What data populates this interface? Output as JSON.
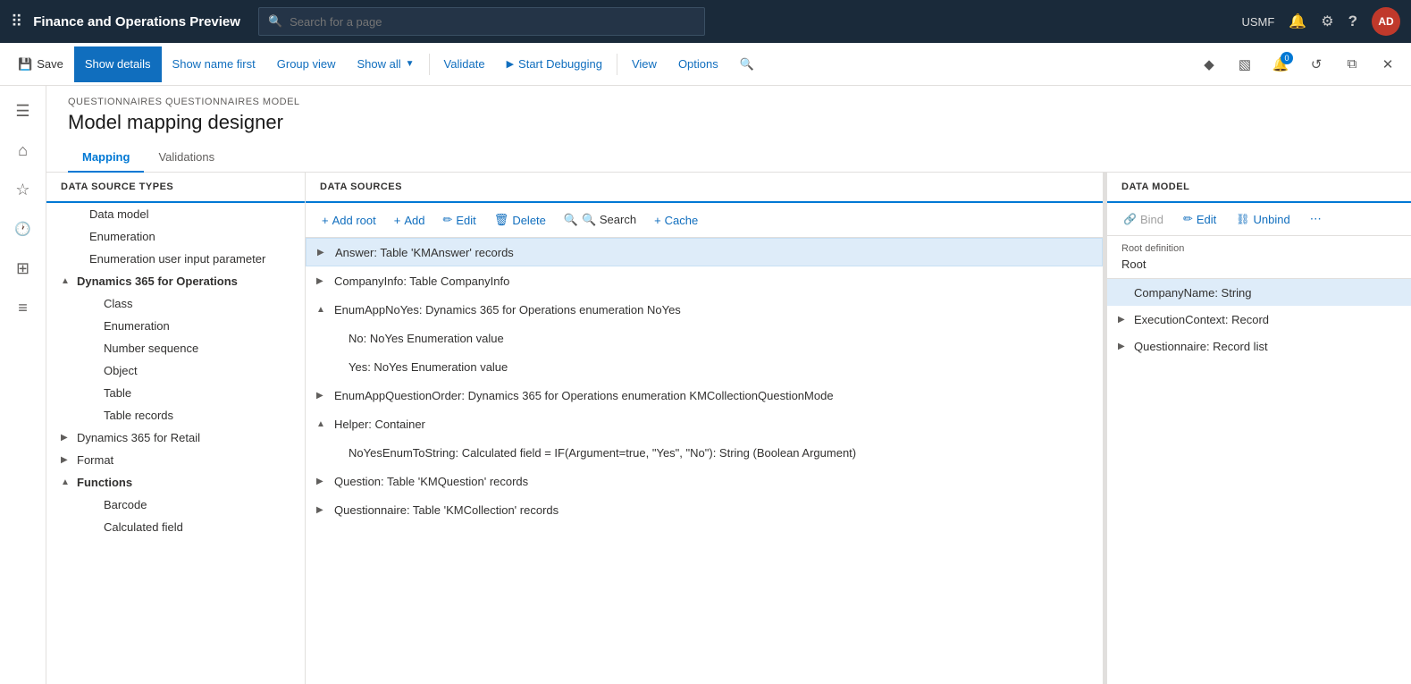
{
  "topbar": {
    "app_title": "Finance and Operations Preview",
    "search_placeholder": "Search for a page",
    "user": "USMF"
  },
  "commandbar": {
    "save_label": "Save",
    "show_details_label": "Show details",
    "show_name_first_label": "Show name first",
    "group_view_label": "Group view",
    "show_all_label": "Show all",
    "validate_label": "Validate",
    "start_debugging_label": "Start Debugging",
    "view_label": "View",
    "options_label": "Options"
  },
  "page": {
    "breadcrumb": "QUESTIONNAIRES QUESTIONNAIRES MODEL",
    "title": "Model mapping designer",
    "tabs": [
      "Mapping",
      "Validations"
    ]
  },
  "datasource_types_panel": {
    "header": "DATA SOURCE TYPES",
    "items": [
      {
        "label": "Data model",
        "indent": 1,
        "chevron": ""
      },
      {
        "label": "Enumeration",
        "indent": 1,
        "chevron": ""
      },
      {
        "label": "Enumeration user input parameter",
        "indent": 1,
        "chevron": ""
      },
      {
        "label": "Dynamics 365 for Operations",
        "indent": 0,
        "chevron": "▲",
        "expanded": true
      },
      {
        "label": "Class",
        "indent": 2,
        "chevron": ""
      },
      {
        "label": "Enumeration",
        "indent": 2,
        "chevron": ""
      },
      {
        "label": "Number sequence",
        "indent": 2,
        "chevron": ""
      },
      {
        "label": "Object",
        "indent": 2,
        "chevron": ""
      },
      {
        "label": "Table",
        "indent": 2,
        "chevron": ""
      },
      {
        "label": "Table records",
        "indent": 2,
        "chevron": ""
      },
      {
        "label": "Dynamics 365 for Retail",
        "indent": 0,
        "chevron": "▶",
        "expanded": false
      },
      {
        "label": "Format",
        "indent": 0,
        "chevron": "▶",
        "expanded": false
      },
      {
        "label": "Functions",
        "indent": 0,
        "chevron": "▲",
        "expanded": true
      },
      {
        "label": "Barcode",
        "indent": 2,
        "chevron": ""
      },
      {
        "label": "Calculated field",
        "indent": 2,
        "chevron": ""
      }
    ]
  },
  "datasources_panel": {
    "header": "DATA SOURCES",
    "toolbar": {
      "add_root": "+ Add root",
      "add": "+ Add",
      "edit": "✏ Edit",
      "delete": "🗑 Delete",
      "search": "🔍 Search",
      "cache": "+ Cache"
    },
    "items": [
      {
        "label": "Answer: Table 'KMAnswer' records",
        "indent": 0,
        "chevron": "▶",
        "selected": true
      },
      {
        "label": "CompanyInfo: Table CompanyInfo",
        "indent": 0,
        "chevron": "▶"
      },
      {
        "label": "EnumAppNoYes: Dynamics 365 for Operations enumeration NoYes",
        "indent": 0,
        "chevron": "▲",
        "expanded": true
      },
      {
        "label": "No: NoYes Enumeration value",
        "indent": 1
      },
      {
        "label": "Yes: NoYes Enumeration value",
        "indent": 1
      },
      {
        "label": "EnumAppQuestionOrder: Dynamics 365 for Operations enumeration KMCollectionQuestionMode",
        "indent": 0,
        "chevron": "▶"
      },
      {
        "label": "Helper: Container",
        "indent": 0,
        "chevron": "▲",
        "expanded": true
      },
      {
        "label": "NoYesEnumToString: Calculated field = IF(Argument=true, \"Yes\", \"No\"): String (Boolean Argument)",
        "indent": 1
      },
      {
        "label": "Question: Table 'KMQuestion' records",
        "indent": 0,
        "chevron": "▶"
      },
      {
        "label": "Questionnaire: Table 'KMCollection' records",
        "indent": 0,
        "chevron": "▶"
      }
    ]
  },
  "datamodel_panel": {
    "header": "DATA MODEL",
    "toolbar": {
      "bind": "Bind",
      "edit": "Edit",
      "unbind": "Unbind"
    },
    "root_definition_label": "Root definition",
    "root_definition_value": "Root",
    "items": [
      {
        "label": "CompanyName: String",
        "indent": 0,
        "chevron": "",
        "selected": true
      },
      {
        "label": "ExecutionContext: Record",
        "indent": 0,
        "chevron": "▶"
      },
      {
        "label": "Questionnaire: Record list",
        "indent": 0,
        "chevron": "▶"
      }
    ]
  },
  "sidebar": {
    "items": [
      {
        "icon": "☰",
        "name": "hamburger-icon"
      },
      {
        "icon": "⌂",
        "name": "home-icon"
      },
      {
        "icon": "★",
        "name": "favorites-icon"
      },
      {
        "icon": "🕐",
        "name": "recent-icon"
      },
      {
        "icon": "⊞",
        "name": "workspaces-icon"
      },
      {
        "icon": "≡",
        "name": "modules-icon"
      }
    ]
  },
  "icons": {
    "search": "🔍",
    "save": "💾",
    "bell": "🔔",
    "gear": "⚙",
    "help": "?",
    "grid": "⠿",
    "debug": "▶",
    "bind_link": "🔗",
    "edit_pencil": "✏",
    "unbind_chain": "⛓",
    "more": "⋯",
    "close": "✕",
    "restore": "⧉",
    "maximize": "□",
    "refresh": "↺",
    "diamond": "◆",
    "pin": "📌",
    "badge_count": "0"
  }
}
